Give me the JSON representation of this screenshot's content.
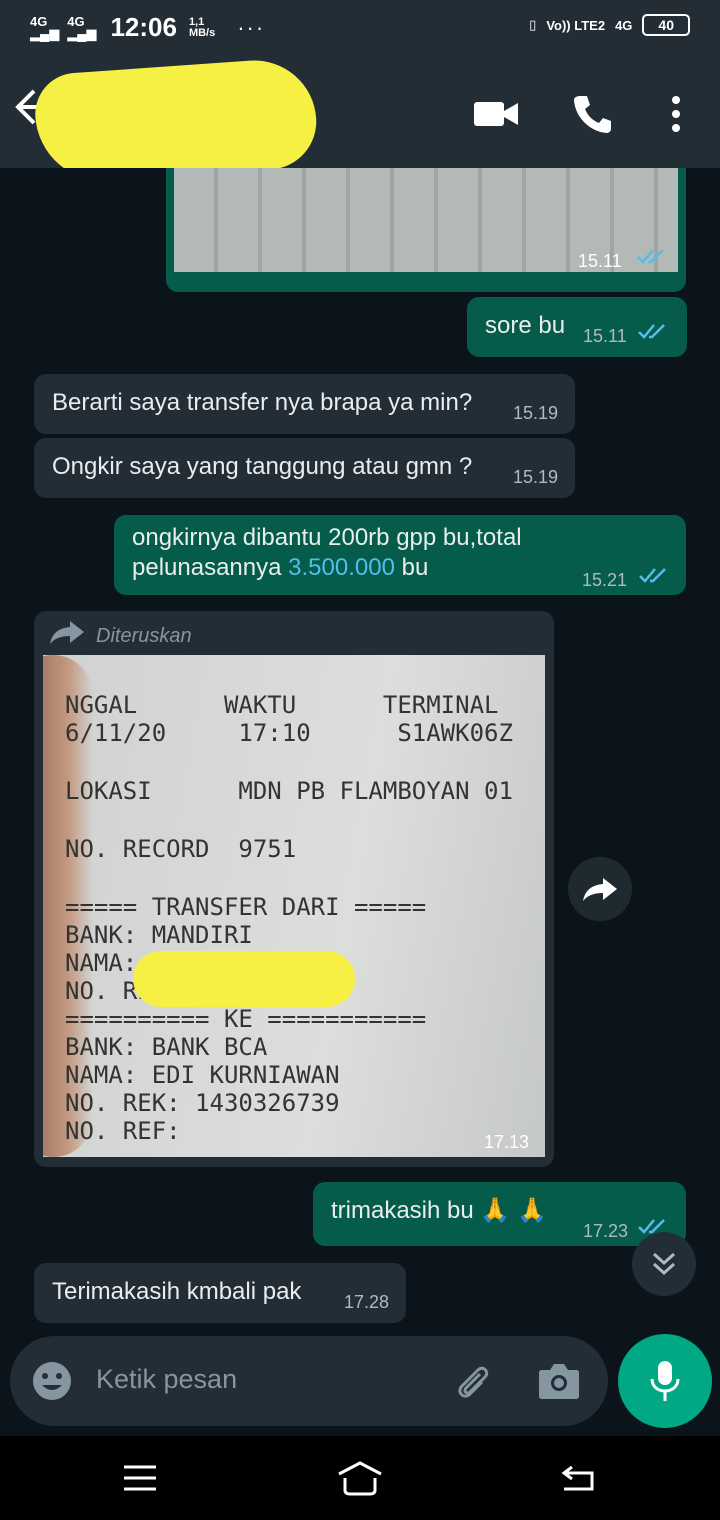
{
  "status_bar": {
    "net1": "4G",
    "net2": "4G",
    "time": "12:06",
    "speed_value": "1,1",
    "speed_unit": "MB/s",
    "dots": "···",
    "volte": "Vo)) LTE2",
    "net3": "4G",
    "battery": "40"
  },
  "header": {
    "icons": [
      "back-arrow-icon",
      "avatar",
      "video-call-icon",
      "phone-call-icon",
      "more-options-icon"
    ]
  },
  "messages": [
    {
      "id": "m0",
      "type": "image",
      "direction": "outgoing",
      "time": "15.11",
      "status": "read"
    },
    {
      "id": "m1",
      "type": "text",
      "direction": "outgoing",
      "text": "sore bu",
      "time": "15.11",
      "status": "read"
    },
    {
      "id": "m2",
      "type": "text",
      "direction": "incoming",
      "text": "Berarti saya transfer nya brapa ya min?",
      "time": "15.19"
    },
    {
      "id": "m3",
      "type": "text",
      "direction": "incoming",
      "text": "Ongkir saya yang tanggung atau gmn ?",
      "time": "15.19"
    },
    {
      "id": "m4",
      "type": "text",
      "direction": "outgoing",
      "line1": "ongkirnya dibantu 200rb gpp bu,total",
      "line2_prefix": "pelunasannya ",
      "line2_link": "3.500.000",
      "line2_suffix": " bu",
      "time": "15.21",
      "status": "read"
    },
    {
      "id": "m5",
      "type": "image",
      "direction": "incoming",
      "forwarded_label": "Diteruskan",
      "time": "17.13"
    },
    {
      "id": "m6",
      "type": "text",
      "direction": "outgoing",
      "text": "trimakasih bu 🙏 🙏",
      "time": "17.23",
      "status": "read"
    },
    {
      "id": "m7",
      "type": "text",
      "direction": "incoming",
      "text": "Terimakasih kmbali pak",
      "time": "17.28"
    }
  ],
  "receipt": {
    "line1": "NGGAL      WAKTU      TERMINAL",
    "line2": "6/11/20     17:10      S1AWK06Z",
    "line3": "LOKASI      MDN PB FLAMBOYAN 01",
    "line4": "NO. RECORD  9751",
    "line5": "===== TRANSFER DARI =====",
    "line6": "BANK: MANDIRI",
    "line7": "NAMA:",
    "line8": "NO. REK",
    "line9": "========== KE ===========",
    "line10": "BANK: BANK BCA",
    "line11": "NAMA: EDI KURNIAWAN",
    "line12": "NO. REK: 1430326739",
    "line13": "NO. REF:"
  },
  "input": {
    "placeholder": "Ketik pesan"
  },
  "colors": {
    "header": "#232d36",
    "chat_bg": "#0b141a",
    "incoming": "#232d36",
    "outgoing": "#065c4b",
    "accent": "#00a884",
    "read_tick": "#53bdeb",
    "link": "#53bdeb"
  }
}
